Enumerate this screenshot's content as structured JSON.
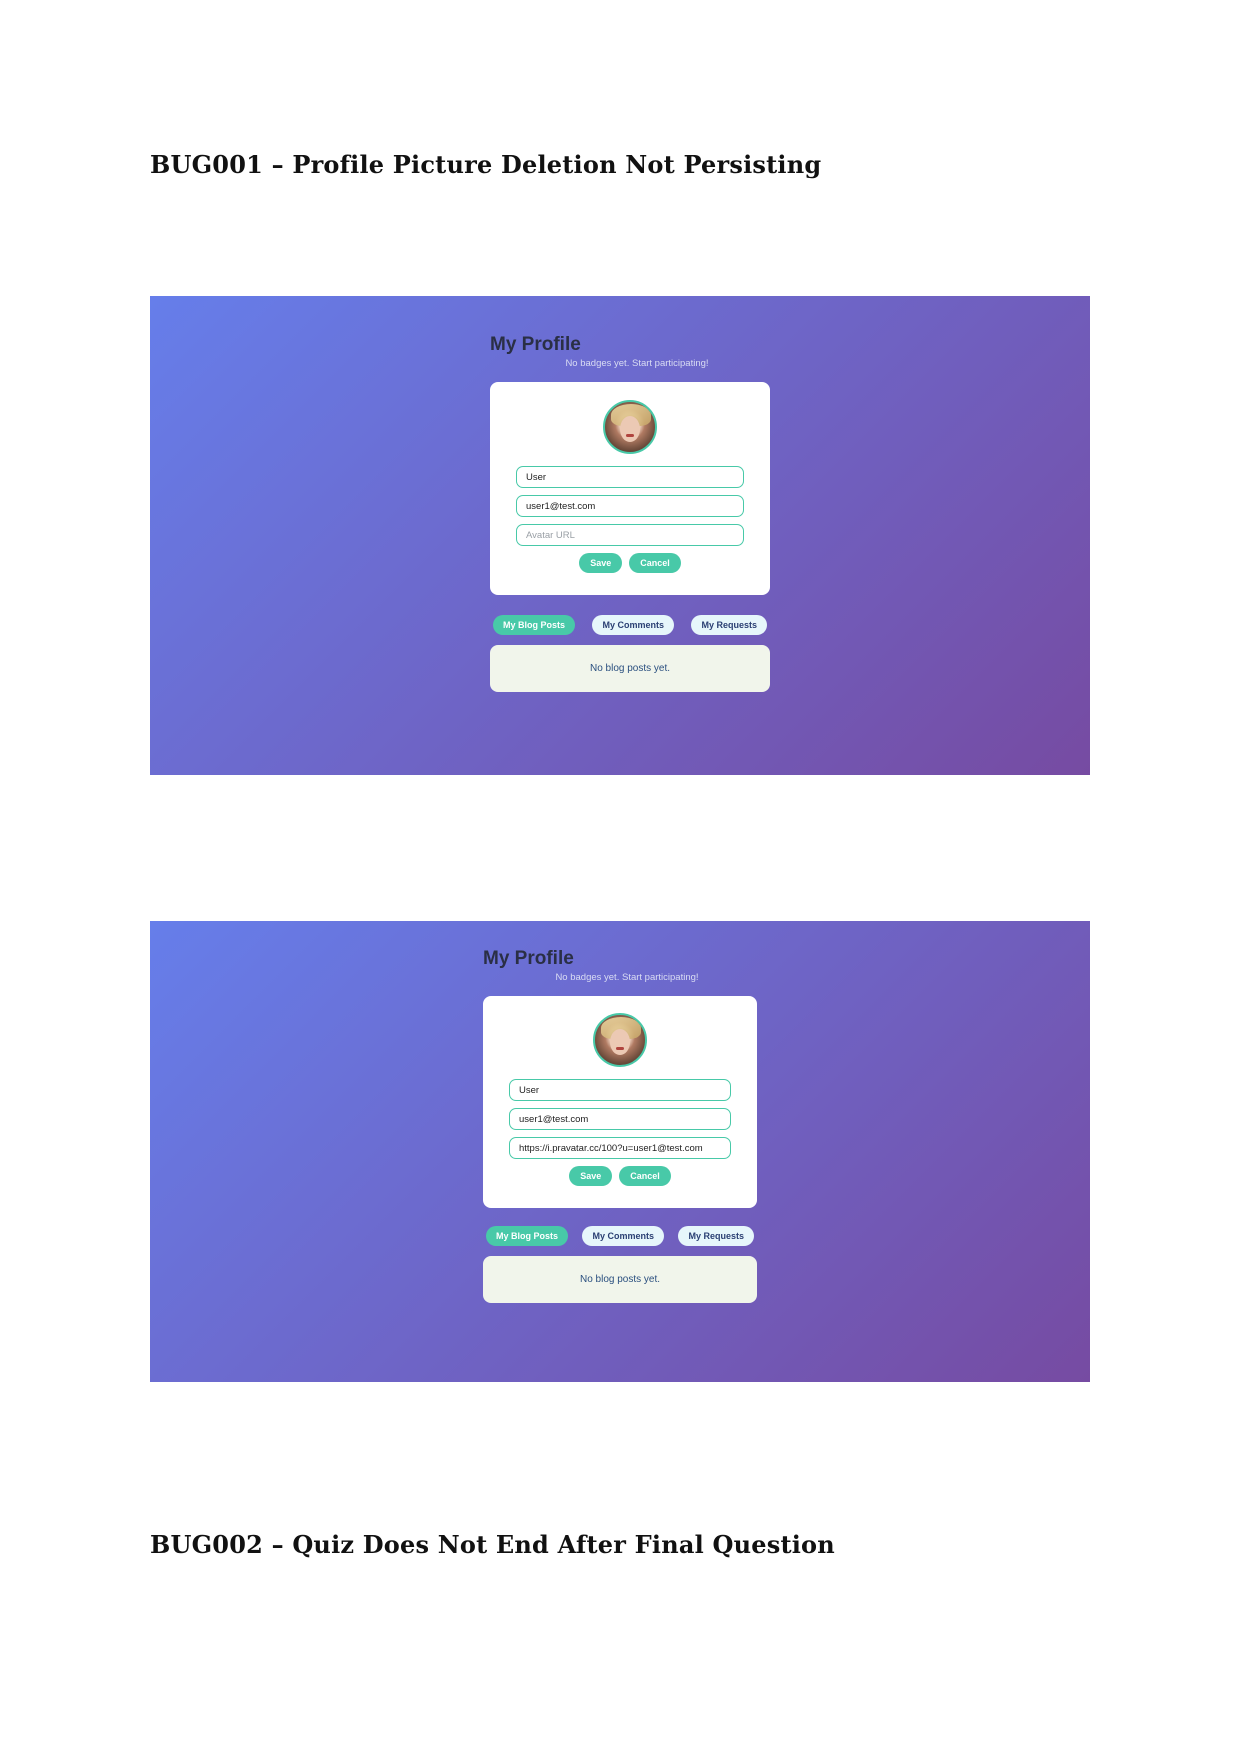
{
  "bug1": {
    "heading": "BUG001 – Profile Picture Deletion Not Persisting",
    "screenshots": [
      {
        "page_title": "My Profile",
        "badges_text": "No badges yet. Start participating!",
        "name_value": "User",
        "email_value": "user1@test.com",
        "avatar_url_value": "",
        "avatar_url_placeholder": "Avatar URL",
        "save_label": "Save",
        "cancel_label": "Cancel",
        "tabs": [
          "My Blog Posts",
          "My Comments",
          "My Requests"
        ],
        "active_tab": "My Blog Posts",
        "empty_posts_text": "No blog posts yet."
      },
      {
        "page_title": "My Profile",
        "badges_text": "No badges yet. Start participating!",
        "name_value": "User",
        "email_value": "user1@test.com",
        "avatar_url_value": "https://i.pravatar.cc/100?u=user1@test.com",
        "avatar_url_placeholder": "Avatar URL",
        "save_label": "Save",
        "cancel_label": "Cancel",
        "tabs": [
          "My Blog Posts",
          "My Comments",
          "My Requests"
        ],
        "active_tab": "My Blog Posts",
        "empty_posts_text": "No blog posts yet."
      }
    ]
  },
  "bug2": {
    "heading": "BUG002 – Quiz Does Not End After Final Question"
  },
  "colors": {
    "gradient_start": "#667eea",
    "gradient_end": "#764ba2",
    "accent": "#48c9a8",
    "tab_inactive_bg": "#e6f6fb"
  },
  "icons": {
    "avatar": "profile-photo"
  }
}
